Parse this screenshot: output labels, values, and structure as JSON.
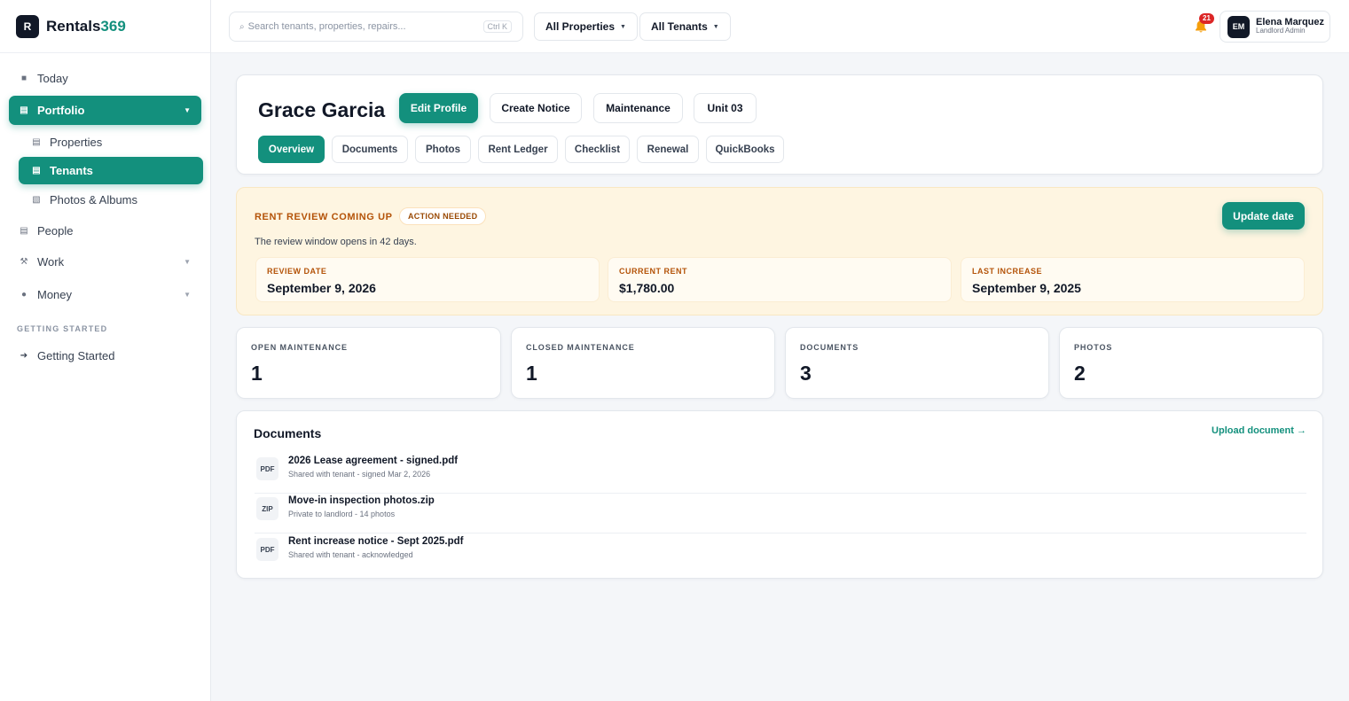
{
  "brand": {
    "mark": "R",
    "name": "Rentals",
    "name_accent": "369"
  },
  "sidebar": {
    "items": [
      {
        "label": "Today",
        "icon": "square-icon"
      },
      {
        "label": "Portfolio",
        "icon": "list-icon",
        "active": true
      },
      {
        "label": "Properties",
        "icon": "list-icon",
        "sub": true
      },
      {
        "label": "Tenants",
        "icon": "list-icon",
        "sub": true,
        "active": true
      },
      {
        "label": "Photos & Albums",
        "icon": "image-icon",
        "sub": true
      },
      {
        "label": "People",
        "icon": "list-icon"
      },
      {
        "label": "Work",
        "icon": "tools-icon"
      },
      {
        "label": "Money",
        "icon": "coin-icon"
      }
    ],
    "section_label": "GETTING STARTED",
    "getting_started": "Getting Started"
  },
  "header": {
    "search_placeholder": "Search tenants, properties, repairs...",
    "search_shortcut": "Ctrl K",
    "filter_properties": "All Properties",
    "filter_tenants": "All Tenants",
    "notification_count": "21",
    "user": {
      "initials": "EM",
      "name": "Elena Marquez",
      "role": "Landlord Admin"
    }
  },
  "profile": {
    "name": "Grace Garcia",
    "actions": [
      "Edit Profile",
      "Create Notice",
      "Maintenance",
      "Unit 03"
    ],
    "tabs": [
      "Overview",
      "Documents",
      "Photos",
      "Rent Ledger",
      "Checklist",
      "Renewal",
      "QuickBooks"
    ],
    "active_tab": "Overview"
  },
  "rent_review": {
    "title": "RENT REVIEW COMING UP",
    "badge": "ACTION NEEDED",
    "description": "The review window opens in 42 days.",
    "button": "Update date",
    "stats": [
      {
        "label": "REVIEW DATE",
        "value": "September 9, 2026"
      },
      {
        "label": "CURRENT RENT",
        "value": "$1,780.00"
      },
      {
        "label": "LAST INCREASE",
        "value": "September 9, 2025"
      }
    ]
  },
  "metrics": [
    {
      "label": "OPEN MAINTENANCE",
      "value": "1"
    },
    {
      "label": "CLOSED MAINTENANCE",
      "value": "1"
    },
    {
      "label": "DOCUMENTS",
      "value": "3"
    },
    {
      "label": "PHOTOS",
      "value": "2"
    }
  ],
  "documents": {
    "title": "Documents",
    "upload_link": "Upload document →",
    "items": [
      {
        "type": "PDF",
        "name": "2026 Lease agreement - signed.pdf",
        "meta": "Shared with tenant - signed Mar 2, 2026"
      },
      {
        "type": "ZIP",
        "name": "Move-in inspection photos.zip",
        "meta": "Private to landlord - 14 photos"
      },
      {
        "type": "PDF",
        "name": "Rent increase notice - Sept 2025.pdf",
        "meta": "Shared with tenant - acknowledged"
      }
    ]
  },
  "colors": {
    "accent": "#13907d",
    "warning_bg": "#fef5e1",
    "warning_text": "#b45309",
    "badge": "#dc2626"
  }
}
